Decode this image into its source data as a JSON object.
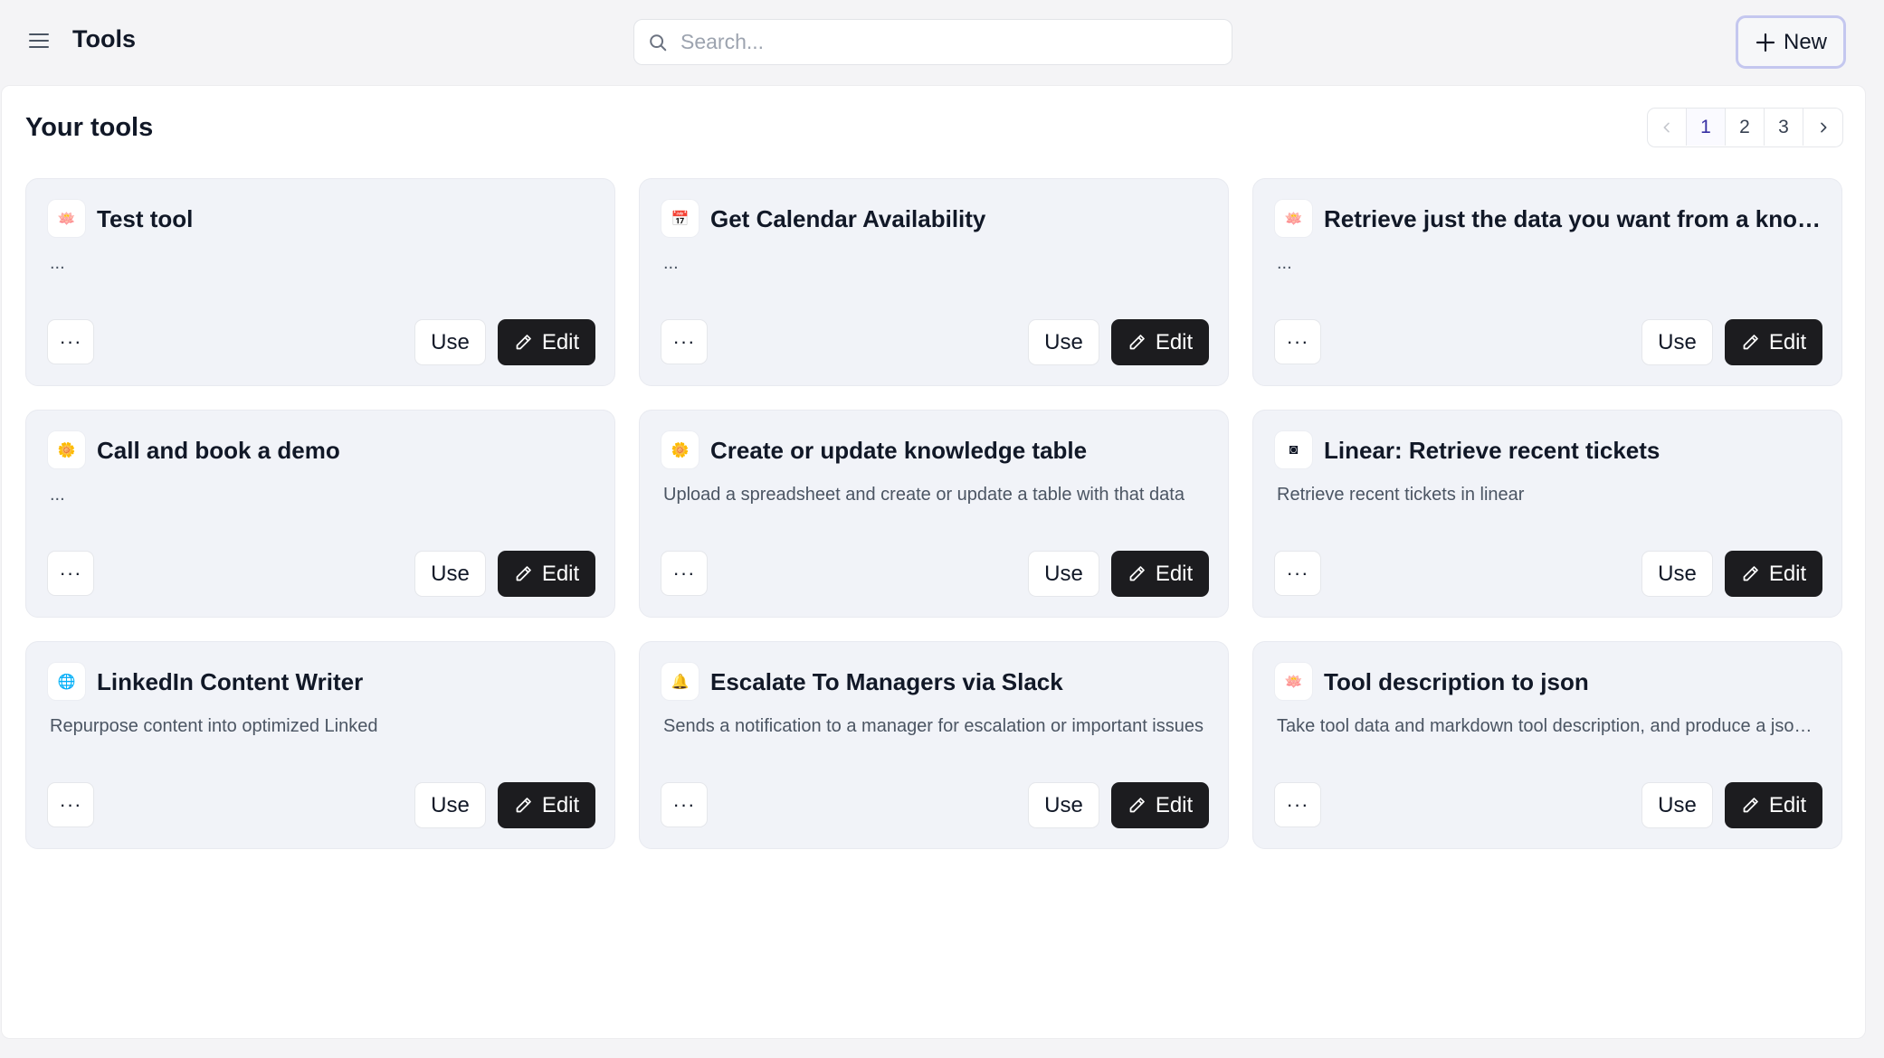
{
  "header": {
    "title": "Tools",
    "search_placeholder": "Search...",
    "new_label": "New"
  },
  "section": {
    "title": "Your tools"
  },
  "pagination": {
    "pages": [
      "1",
      "2",
      "3"
    ],
    "active": "1"
  },
  "card_actions": {
    "more_label": "···",
    "use_label": "Use",
    "edit_label": "Edit"
  },
  "tools": [
    {
      "title": "Test tool",
      "description": "...",
      "icon": "lotus-icon",
      "icon_glyph": "🪷"
    },
    {
      "title": "Get Calendar Availability",
      "description": "...",
      "icon": "calendar-icon",
      "icon_glyph": "📅"
    },
    {
      "title": "Retrieve just the data you want from a knowledge table",
      "description": "...",
      "icon": "lotus-icon",
      "icon_glyph": "🪷"
    },
    {
      "title": "Call and book a demo",
      "description": "...",
      "icon": "flower-icon",
      "icon_glyph": "🌼"
    },
    {
      "title": "Create or update knowledge table",
      "description": "Upload a spreadsheet and create or update a table with that data",
      "icon": "flower-icon",
      "icon_glyph": "🌼"
    },
    {
      "title": "Linear: Retrieve recent tickets",
      "description": "Retrieve recent tickets in linear",
      "icon": "linear-icon",
      "icon_glyph": "◙"
    },
    {
      "title": "LinkedIn Content Writer",
      "description": "Repurpose content into optimized Linked",
      "icon": "globe-icon",
      "icon_glyph": "🌐"
    },
    {
      "title": "Escalate To Managers via Slack",
      "description": "Sends a notification to a manager for escalation or important issues",
      "icon": "bell-icon",
      "icon_glyph": "🔔"
    },
    {
      "title": "Tool description to json",
      "description": "Take tool data and markdown tool description, and produce a json schema",
      "icon": "lotus-icon",
      "icon_glyph": "🪷"
    }
  ],
  "colors": {
    "accent": "#3730a3",
    "edit_button": "#1c1c1f",
    "card_background": "#f1f3f8"
  }
}
